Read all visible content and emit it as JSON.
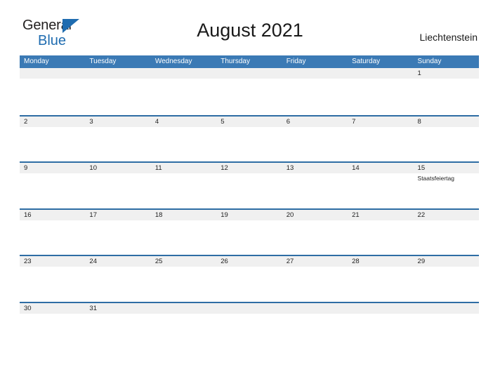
{
  "brand": {
    "name_part1": "General",
    "name_part2": "Blue",
    "triangle_color": "#1f6cb0"
  },
  "header": {
    "title": "August 2021",
    "location": "Liechtenstein"
  },
  "colors": {
    "header_blue": "#3b7ab5",
    "row_divider_blue": "#2e6da4",
    "day_band_gray": "#f0f0f0",
    "text_dark": "#222222"
  },
  "calendar": {
    "weekdays": [
      "Monday",
      "Tuesday",
      "Wednesday",
      "Thursday",
      "Friday",
      "Saturday",
      "Sunday"
    ],
    "weeks": [
      {
        "days": [
          {
            "num": "",
            "event": ""
          },
          {
            "num": "",
            "event": ""
          },
          {
            "num": "",
            "event": ""
          },
          {
            "num": "",
            "event": ""
          },
          {
            "num": "",
            "event": ""
          },
          {
            "num": "",
            "event": ""
          },
          {
            "num": "1",
            "event": ""
          }
        ]
      },
      {
        "days": [
          {
            "num": "2",
            "event": ""
          },
          {
            "num": "3",
            "event": ""
          },
          {
            "num": "4",
            "event": ""
          },
          {
            "num": "5",
            "event": ""
          },
          {
            "num": "6",
            "event": ""
          },
          {
            "num": "7",
            "event": ""
          },
          {
            "num": "8",
            "event": ""
          }
        ]
      },
      {
        "days": [
          {
            "num": "9",
            "event": ""
          },
          {
            "num": "10",
            "event": ""
          },
          {
            "num": "11",
            "event": ""
          },
          {
            "num": "12",
            "event": ""
          },
          {
            "num": "13",
            "event": ""
          },
          {
            "num": "14",
            "event": ""
          },
          {
            "num": "15",
            "event": "Staatsfeiertag"
          }
        ]
      },
      {
        "days": [
          {
            "num": "16",
            "event": ""
          },
          {
            "num": "17",
            "event": ""
          },
          {
            "num": "18",
            "event": ""
          },
          {
            "num": "19",
            "event": ""
          },
          {
            "num": "20",
            "event": ""
          },
          {
            "num": "21",
            "event": ""
          },
          {
            "num": "22",
            "event": ""
          }
        ]
      },
      {
        "days": [
          {
            "num": "23",
            "event": ""
          },
          {
            "num": "24",
            "event": ""
          },
          {
            "num": "25",
            "event": ""
          },
          {
            "num": "26",
            "event": ""
          },
          {
            "num": "27",
            "event": ""
          },
          {
            "num": "28",
            "event": ""
          },
          {
            "num": "29",
            "event": ""
          }
        ]
      },
      {
        "days": [
          {
            "num": "30",
            "event": ""
          },
          {
            "num": "31",
            "event": ""
          },
          {
            "num": "",
            "event": ""
          },
          {
            "num": "",
            "event": ""
          },
          {
            "num": "",
            "event": ""
          },
          {
            "num": "",
            "event": ""
          },
          {
            "num": "",
            "event": ""
          }
        ]
      }
    ]
  }
}
